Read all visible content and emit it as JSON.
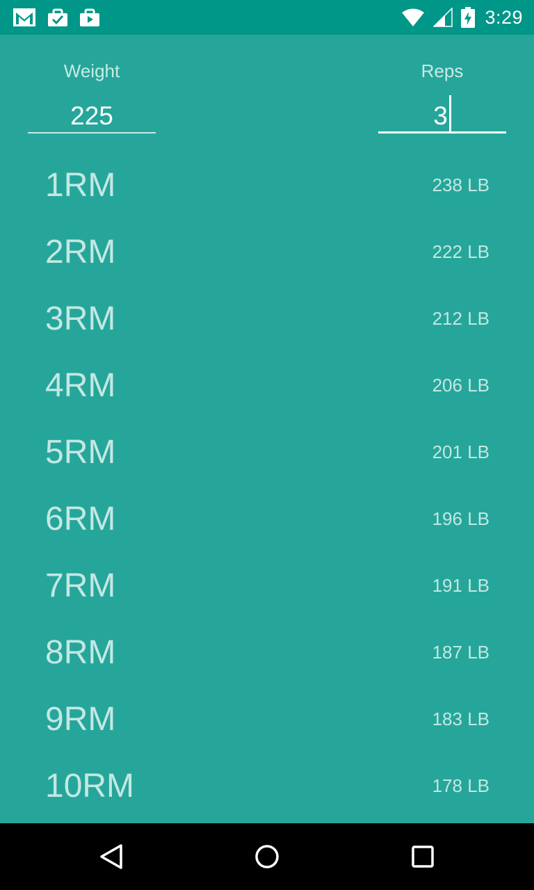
{
  "status_bar": {
    "time": "3:29",
    "left_icons": [
      "gmail-icon",
      "tasks-icon",
      "store-icon"
    ],
    "right_icons": [
      "wifi-icon",
      "signal-icon",
      "battery-charging-icon"
    ]
  },
  "inputs": {
    "weight": {
      "label": "Weight",
      "value": "225"
    },
    "reps": {
      "label": "Reps",
      "value": "3"
    }
  },
  "rm_rows": [
    {
      "label": "1RM",
      "value": "238 LB"
    },
    {
      "label": "2RM",
      "value": "222 LB"
    },
    {
      "label": "3RM",
      "value": "212 LB"
    },
    {
      "label": "4RM",
      "value": "206 LB"
    },
    {
      "label": "5RM",
      "value": "201 LB"
    },
    {
      "label": "6RM",
      "value": "196 LB"
    },
    {
      "label": "7RM",
      "value": "191 LB"
    },
    {
      "label": "8RM",
      "value": "187 LB"
    },
    {
      "label": "9RM",
      "value": "183 LB"
    },
    {
      "label": "10RM",
      "value": "178 LB"
    }
  ],
  "nav_bar": {
    "buttons": [
      "back-icon",
      "home-icon",
      "recents-icon"
    ]
  },
  "colors": {
    "status_bar": "#009688",
    "background": "#26a69a",
    "text_primary": "#ffffff",
    "text_muted": "#c3e8e3",
    "nav_bar": "#000000"
  }
}
